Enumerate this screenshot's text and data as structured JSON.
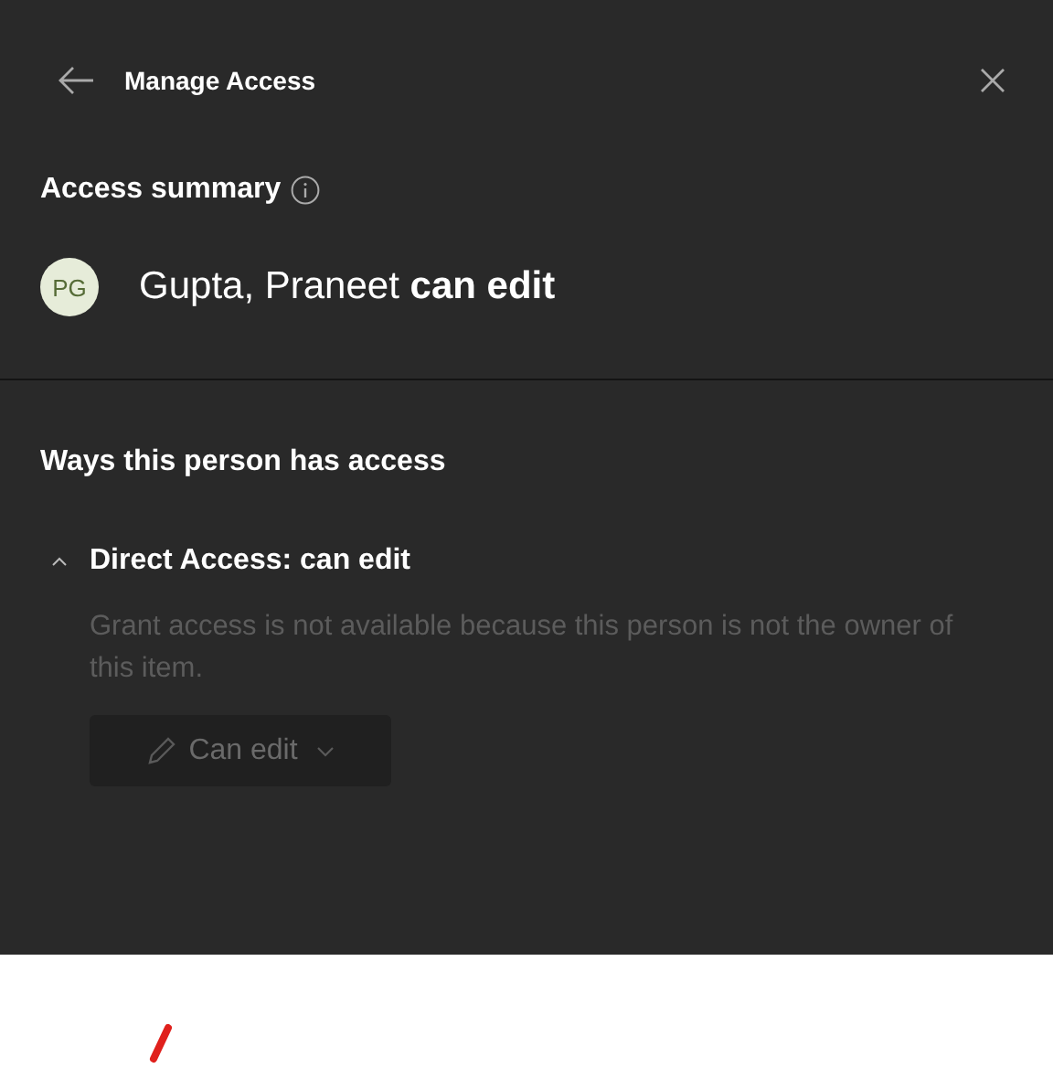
{
  "header": {
    "title": "Manage Access"
  },
  "summary": {
    "heading": "Access summary",
    "avatar_initials": "PG",
    "person": "Gupta, Praneet **can edit**"
  },
  "ways": {
    "heading": "Ways this person has access",
    "groups": [
      {
        "title": "Direct Access: can edit",
        "expanded": true,
        "note": "Grant access is not available because this person is not the owner of this item.",
        "permission_button": {
          "label": "Can edit",
          "disabled": true
        }
      }
    ]
  }
}
